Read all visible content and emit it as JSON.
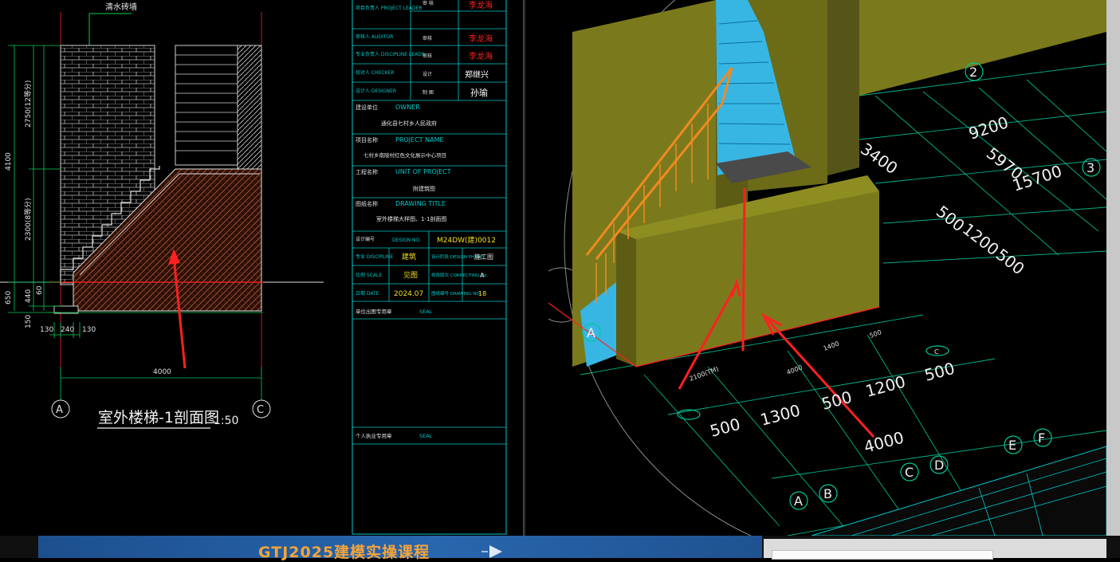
{
  "cad": {
    "section_title": "室外楼梯-1剖面图",
    "scale": "1:50",
    "top_label": "清水砖墙",
    "grid_left": "A",
    "grid_right": "C",
    "dim_bottom": "4000",
    "dim_bottom_parts": [
      "130",
      "240",
      "130"
    ],
    "dim_left": [
      "4100",
      "2750(12等分)",
      "2300(8等分)",
      "650",
      "440",
      "60",
      "150"
    ]
  },
  "title_block": {
    "rows": [
      {
        "label": "项目负责人\nPROJECT LEADER",
        "role": "审 核",
        "sig": "李龙海"
      },
      {
        "label": "审核人\nAUDITOR",
        "role": "审核",
        "sig": "李龙海"
      },
      {
        "label": "专业负责人\nDISCIPLINE LEADS",
        "role": "审核",
        "sig": "李龙海"
      },
      {
        "label": "校对人\nCHECKER",
        "role": "设计",
        "sig": "郑继兴"
      },
      {
        "label": "设计人\nDESIGNER",
        "role": "制 图",
        "sig": "孙瑜"
      }
    ],
    "owner_label": "建设单位",
    "owner_en": "OWNER",
    "owner_value": "通化县七村乡人民政府",
    "project_label": "项目名称",
    "project_en": "PROJECT NAME",
    "project_value": "七村乡南陵村红色文化展示中心项目",
    "unit_label": "工程名称",
    "unit_en": "UNIT OF PROJECT",
    "unit_value": "附建筑图",
    "drawing_label": "图纸名称",
    "drawing_en": "DRAWING TITLE",
    "drawing_value": "室外楼梯大样图、1-1剖面图",
    "design_no_label": "设计编号",
    "design_no_en": "DESIGN NO.",
    "design_no_value": "M24DW(建)0012",
    "discipline_label": "专业\nDISCIPLINE",
    "discipline_value": "建筑",
    "phase_label": "设计阶段\nDESIGN PHASE",
    "phase_value": "施工图",
    "scale_label": "比例\nSCALE",
    "scale_value": "见图",
    "correcting_label": "修改版次\nCORRECTING No.",
    "correcting_value": "A",
    "date_label": "日期\nDATE",
    "date_value": "2024.07",
    "drawing_no_label": "图纸编号\nDRAWING NO.",
    "drawing_no_value": "18",
    "seal1_label": "单位出图专用章",
    "seal1_en": "SEAL",
    "seal2_label": "个人执业专用章",
    "seal2_en": "SEAL"
  },
  "model": {
    "dims": [
      "9200",
      "5970",
      "15700",
      "3400",
      "500",
      "1200",
      "500",
      "500",
      "1300",
      "500",
      "1200",
      "500",
      "4000",
      "2100(TM)",
      "4000",
      "1400",
      "500"
    ],
    "grid_labels": [
      "2",
      "3",
      "A",
      "A",
      "B",
      "C",
      "D",
      "E",
      "F",
      "C"
    ]
  },
  "banner": {
    "title": "GTJ2025建模实操课程"
  },
  "colors": {
    "cad_line": "#00c8c8",
    "dim": "#00cc55",
    "wall": "#7a7a1c",
    "stair": "#37b6e4",
    "annotation_red": "#ff2020",
    "banner": "#2866ae",
    "banner_text": "#f3a43a"
  }
}
